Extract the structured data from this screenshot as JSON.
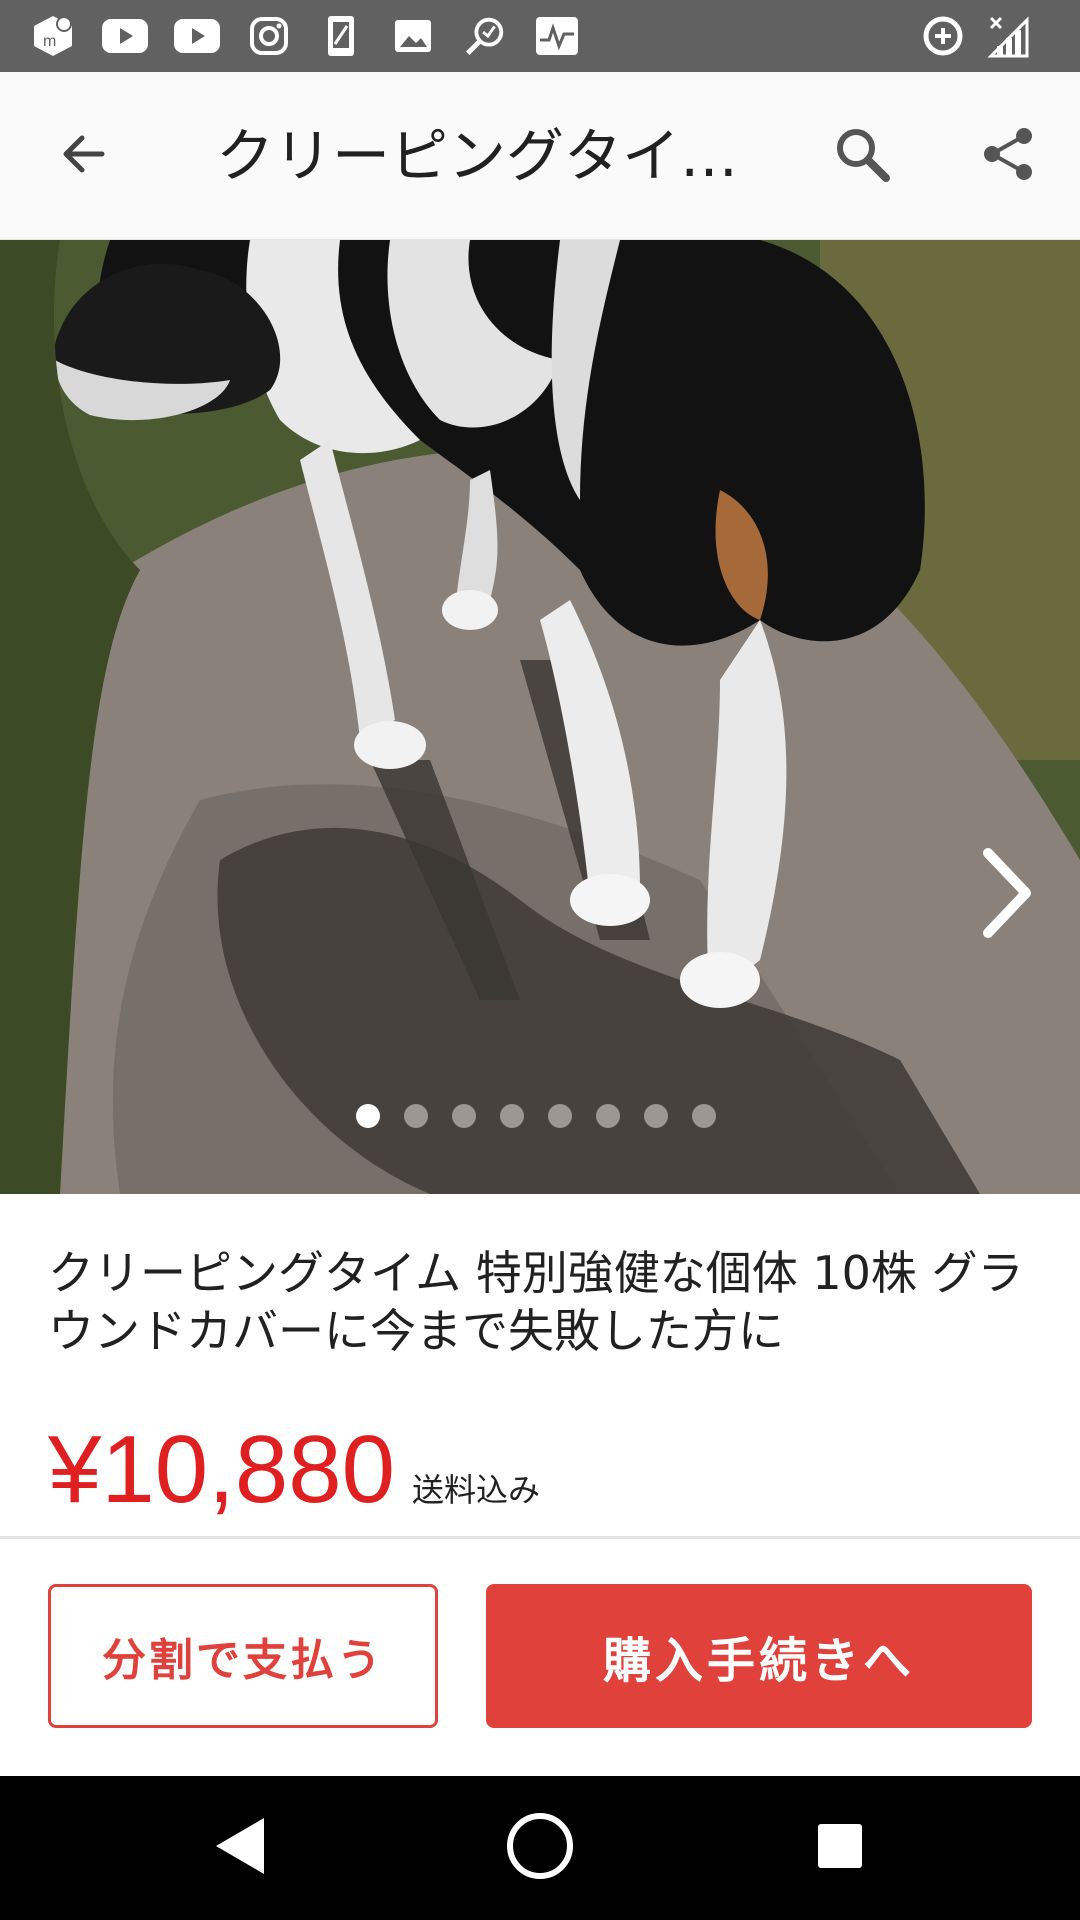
{
  "status_bar": {
    "left_icons": [
      "mercari-icon",
      "youtube-icon",
      "youtube-icon",
      "instagram-icon",
      "phone-icon",
      "image-icon",
      "magnifier-icon",
      "activity-icon"
    ],
    "right_icons": [
      "data-saver-icon",
      "signal-icon"
    ]
  },
  "app_bar": {
    "title": "クリーピングタイ…",
    "back_icon": "arrow-back-icon",
    "search_icon": "search-icon",
    "share_icon": "share-icon"
  },
  "gallery": {
    "image_count": 8,
    "active_index": 0,
    "next_icon": "chevron-right-icon"
  },
  "product": {
    "title": "クリーピングタイム 特別強健な個体 10株 グラウンドカバーに今まで失敗した方に",
    "price": "¥10,880",
    "shipping": "送料込み"
  },
  "actions": {
    "installment_label": "分割で支払う",
    "purchase_label": "購入手続きへ"
  },
  "colors": {
    "accent": "#e0413a",
    "price": "#e02020",
    "status_bar": "#616161",
    "nav_bar": "#000000"
  },
  "nav_bar": {
    "icons": [
      "back-triangle-icon",
      "home-circle-icon",
      "recents-square-icon"
    ]
  }
}
